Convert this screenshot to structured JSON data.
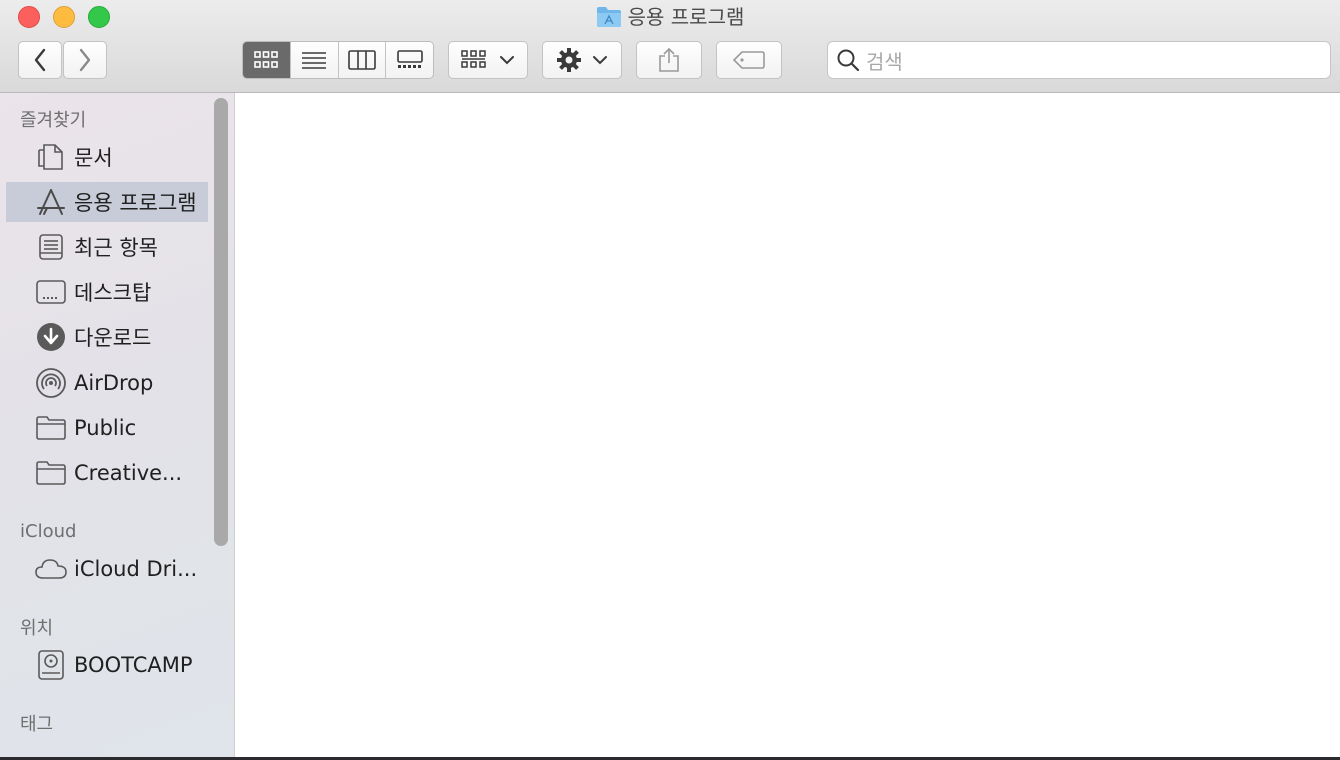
{
  "window": {
    "title": "응용 프로그램"
  },
  "toolbar": {
    "view_modes": [
      "icon-view",
      "list-view",
      "column-view",
      "gallery-view"
    ],
    "active_view": "icon-view",
    "search_placeholder": "검색"
  },
  "sidebar": {
    "favorites_header": "즐겨찾기",
    "favorites": [
      {
        "label": "문서",
        "icon": "document-icon"
      },
      {
        "label": "응용 프로그램",
        "icon": "applications-icon",
        "selected": true
      },
      {
        "label": "최근 항목",
        "icon": "recents-icon"
      },
      {
        "label": "데스크탑",
        "icon": "desktop-icon"
      },
      {
        "label": "다운로드",
        "icon": "download-icon"
      },
      {
        "label": "AirDrop",
        "icon": "airdrop-icon"
      },
      {
        "label": "Public",
        "icon": "folder-icon"
      },
      {
        "label": "Creative...",
        "icon": "folder-icon"
      }
    ],
    "icloud_header": "iCloud",
    "icloud": [
      {
        "label": "iCloud Dri...",
        "icon": "cloud-icon"
      }
    ],
    "locations_header": "위치",
    "locations": [
      {
        "label": "BOOTCAMP",
        "icon": "hard-drive-icon"
      }
    ],
    "tags_header": "태그"
  },
  "colors": {
    "selected_row": "#c8cbd8",
    "close": "#fc605c",
    "minimize": "#fdbc40",
    "maximize": "#34c84a"
  }
}
